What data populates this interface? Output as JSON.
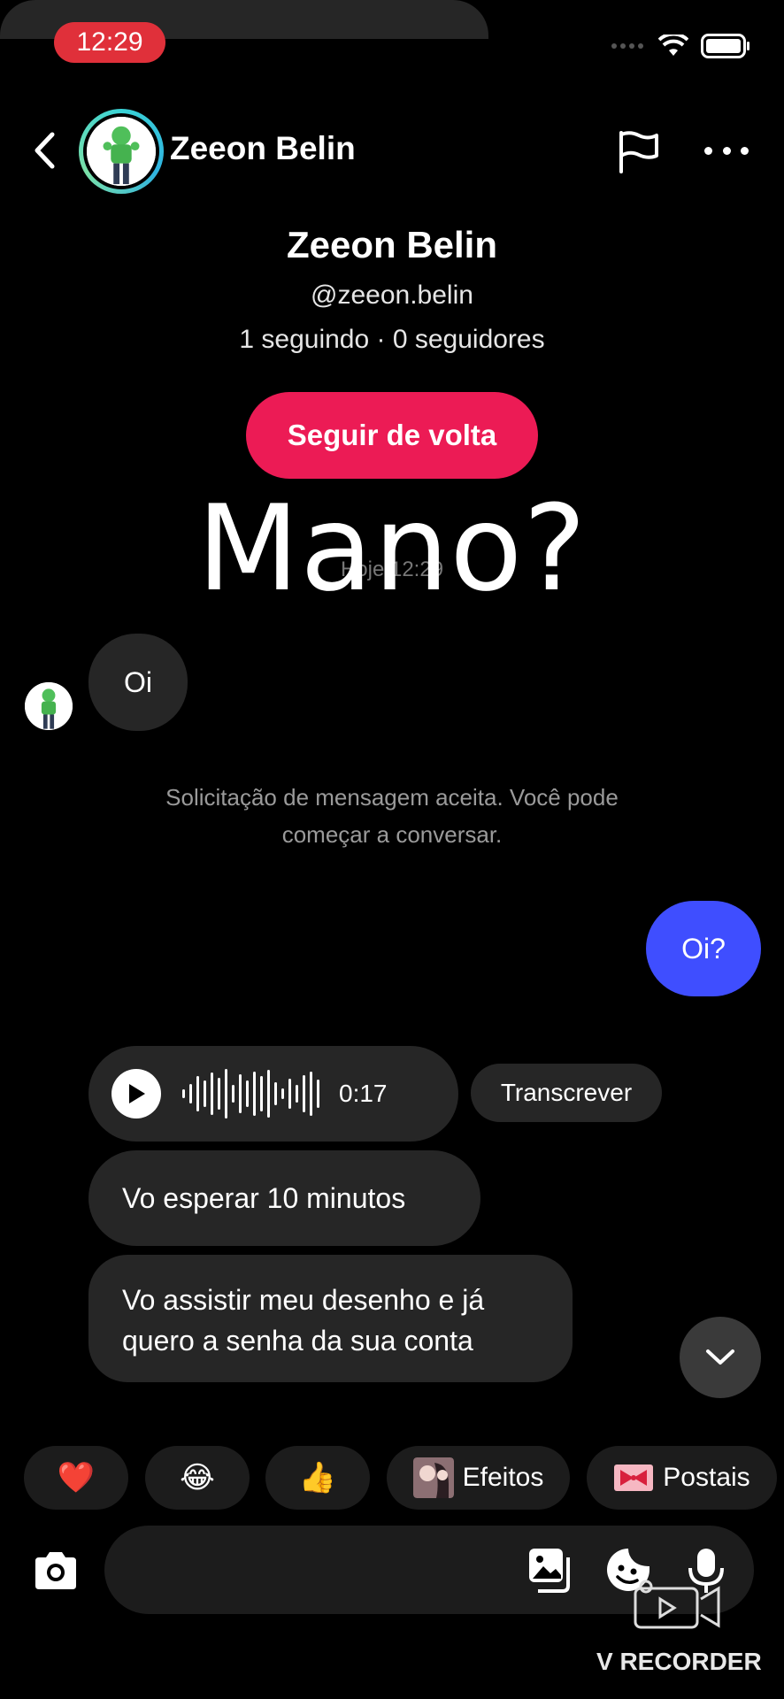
{
  "status": {
    "time": "12:29"
  },
  "header": {
    "name": "Zeeon Belin"
  },
  "profile": {
    "name": "Zeeon Belin",
    "handle": "@zeeon.belin",
    "stats": "1 seguindo · 0 seguidores",
    "follow_label": "Seguir de volta"
  },
  "chat": {
    "date_label": "Hoje 12:29",
    "overlay_caption": "Mano?",
    "messages": {
      "incoming_1": "Oi",
      "system": "Solicitação de mensagem aceita. Você pode começar a conversar.",
      "outgoing_1": "Oi?",
      "voice_duration": "0:17",
      "transcribe_label": "Transcrever",
      "incoming_2": "Vo esperar 10 minutos",
      "incoming_3_line1": "Vo assistir meu desenho e já",
      "incoming_3_line2": "quero a senha da sua conta"
    }
  },
  "quick_replies": {
    "heart": "❤️",
    "laugh": "😂",
    "thumbs_up": "👍",
    "effects_label": "Efeitos",
    "postcards_label": "Postais"
  },
  "composer": {
    "placeholder": ""
  },
  "watermark": {
    "text": "V RECORDER"
  },
  "colors": {
    "follow": "#ec1b55",
    "outgoing_bubble": "#3f4eff",
    "incoming_bubble": "#262626",
    "status_pill": "#e0303a"
  }
}
